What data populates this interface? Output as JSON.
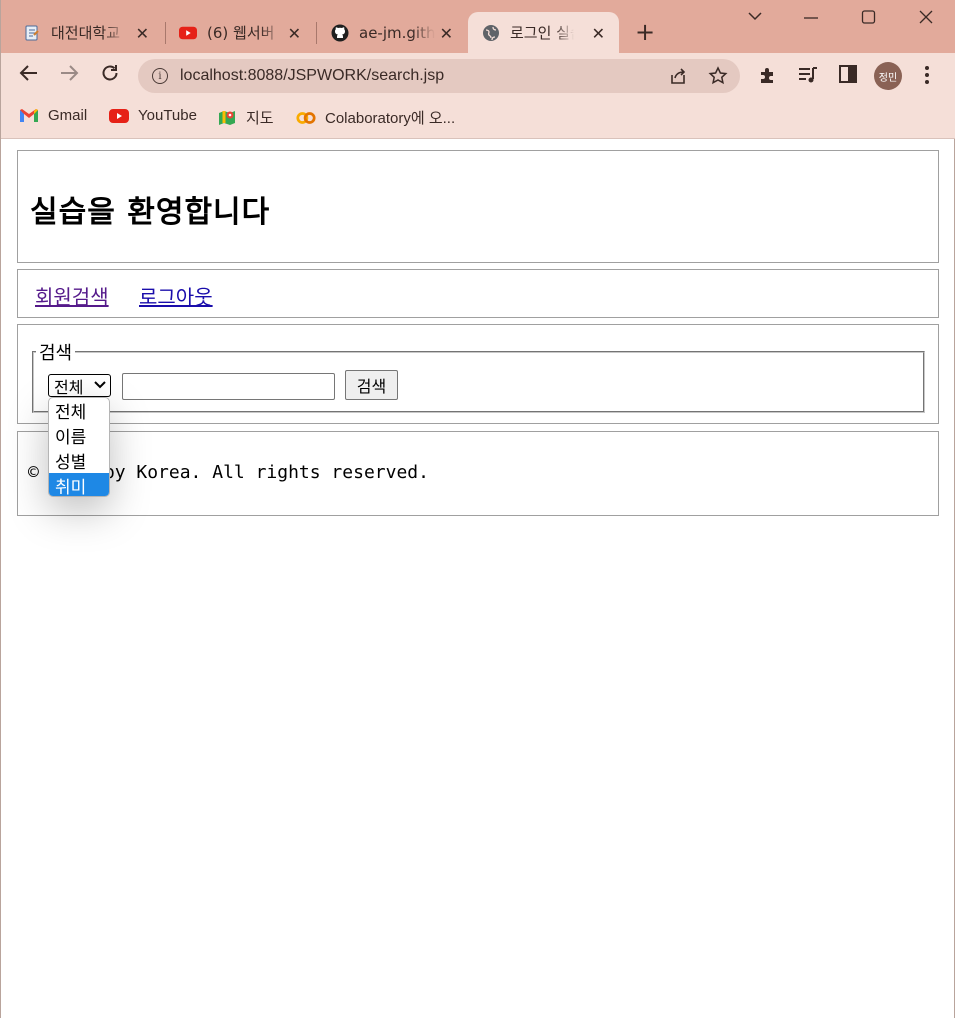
{
  "browser": {
    "tabs": [
      {
        "title": "대전대학교",
        "icon": "document-icon"
      },
      {
        "title": "(6) 웹서버",
        "icon": "youtube-icon"
      },
      {
        "title": "ae-jm.github",
        "icon": "github-icon"
      },
      {
        "title": "로그인 실습",
        "icon": "globe-icon",
        "active": true
      }
    ],
    "url": "localhost:8088/JSPWORK/search.jsp",
    "profile_initials": "정민",
    "bookmarks": [
      {
        "label": "Gmail",
        "icon": "gmail-icon"
      },
      {
        "label": "YouTube",
        "icon": "youtube-icon"
      },
      {
        "label": "지도",
        "icon": "maps-icon"
      },
      {
        "label": "Colaboratory에 오...",
        "icon": "colab-icon"
      }
    ]
  },
  "page": {
    "heading": "실습을  환영합니다",
    "nav": {
      "search_link": "회원검색",
      "logout_link": "로그아웃"
    },
    "search": {
      "legend": "검색",
      "select_value": "전체",
      "options": [
        "전체",
        "이름",
        "성별",
        "취미"
      ],
      "highlighted_option": "취미",
      "button_label": "검색",
      "input_value": ""
    },
    "footer": {
      "text": "© Made by Korea. All rights reserved."
    }
  },
  "colors": {
    "tabstrip": "#e2aa9b",
    "toolbar": "#f5dfd8",
    "link": "#1a0dab",
    "option_highlight": "#1e88e5"
  }
}
